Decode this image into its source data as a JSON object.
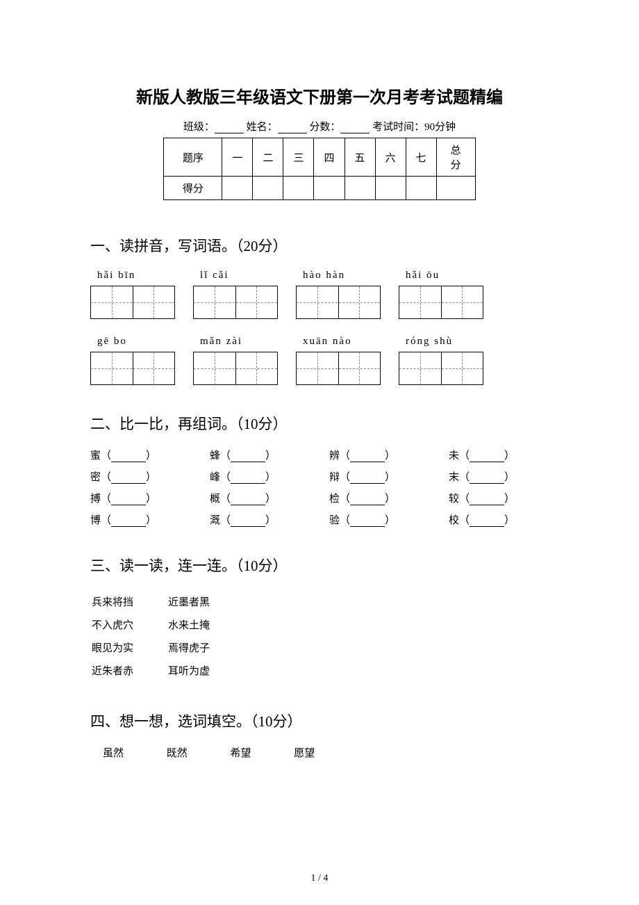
{
  "title": "新版人教版三年级语文下册第一次月考考试题精编",
  "meta": {
    "class_label": "班级：",
    "name_label": "姓名：",
    "score_label": "分数：",
    "time_label": "考试时间：90分钟"
  },
  "score_table": {
    "row1_label": "题序",
    "cols": [
      "一",
      "二",
      "三",
      "四",
      "五",
      "六",
      "七",
      "总分"
    ],
    "row2_label": "得分"
  },
  "sections": {
    "s1": {
      "heading": "一、读拼音，写词语。（20分）",
      "row1": [
        "hǎi bīn",
        "lǐ cǎi",
        "hào hàn",
        "hǎi ōu"
      ],
      "row2": [
        "gē bo",
        "mǎn zài",
        "xuān nào",
        "róng shù"
      ]
    },
    "s2": {
      "heading": "二、比一比，再组词。（10分）",
      "items": [
        [
          "蜜",
          "蜂",
          "辨",
          "未"
        ],
        [
          "密",
          "峰",
          "辩",
          "末"
        ],
        [
          "搏",
          "概",
          "检",
          "较"
        ],
        [
          "博",
          "溉",
          "验",
          "校"
        ]
      ]
    },
    "s3": {
      "heading": "三、读一读，连一连。（10分）",
      "left": [
        "兵来将挡",
        "不入虎穴",
        "眼见为实",
        "近朱者赤"
      ],
      "right": [
        "近墨者黑",
        "水来土掩",
        "焉得虎子",
        "耳听为虚"
      ]
    },
    "s4": {
      "heading": "四、想一想，选词填空。（10分）",
      "words": [
        "虽然",
        "既然",
        "希望",
        "愿望"
      ]
    }
  },
  "page_num": "1 / 4"
}
